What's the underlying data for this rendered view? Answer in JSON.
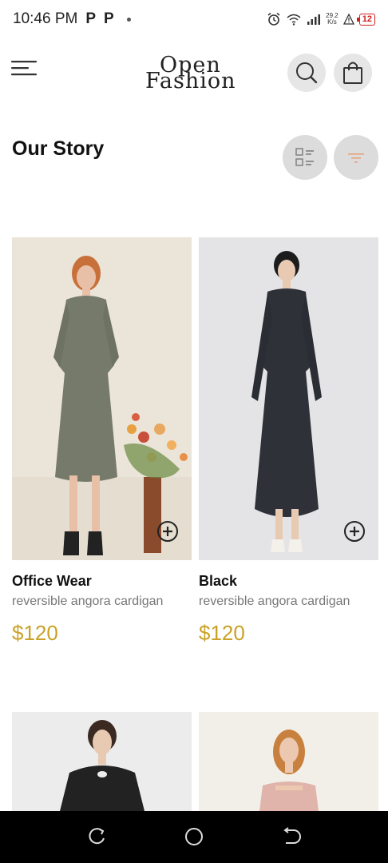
{
  "status_bar": {
    "time": "10:46 PM",
    "notif_1": "P",
    "notif_2": "P",
    "speed_value": "29.2",
    "speed_unit": "K/s",
    "battery": "12"
  },
  "header": {
    "logo_line1": "Open",
    "logo_line2": "Fashion"
  },
  "page": {
    "title": "Our Story"
  },
  "products": [
    {
      "name": "Office Wear",
      "description": "reversible angora cardigan",
      "price": "$120"
    },
    {
      "name": "Black",
      "description": "reversible angora cardigan",
      "price": "$120"
    }
  ],
  "icons": {
    "menu": "menu-icon",
    "search": "search-icon",
    "bag": "shopping-bag-icon",
    "grid_view": "list-view-icon",
    "filter": "filter-icon",
    "add": "add-circle-icon",
    "recent": "recent-apps-icon",
    "home": "home-icon",
    "back": "back-icon"
  },
  "colors": {
    "price": "#c9a227",
    "filter_accent": "#e8a07a",
    "button_bg": "#e6e6e6"
  }
}
